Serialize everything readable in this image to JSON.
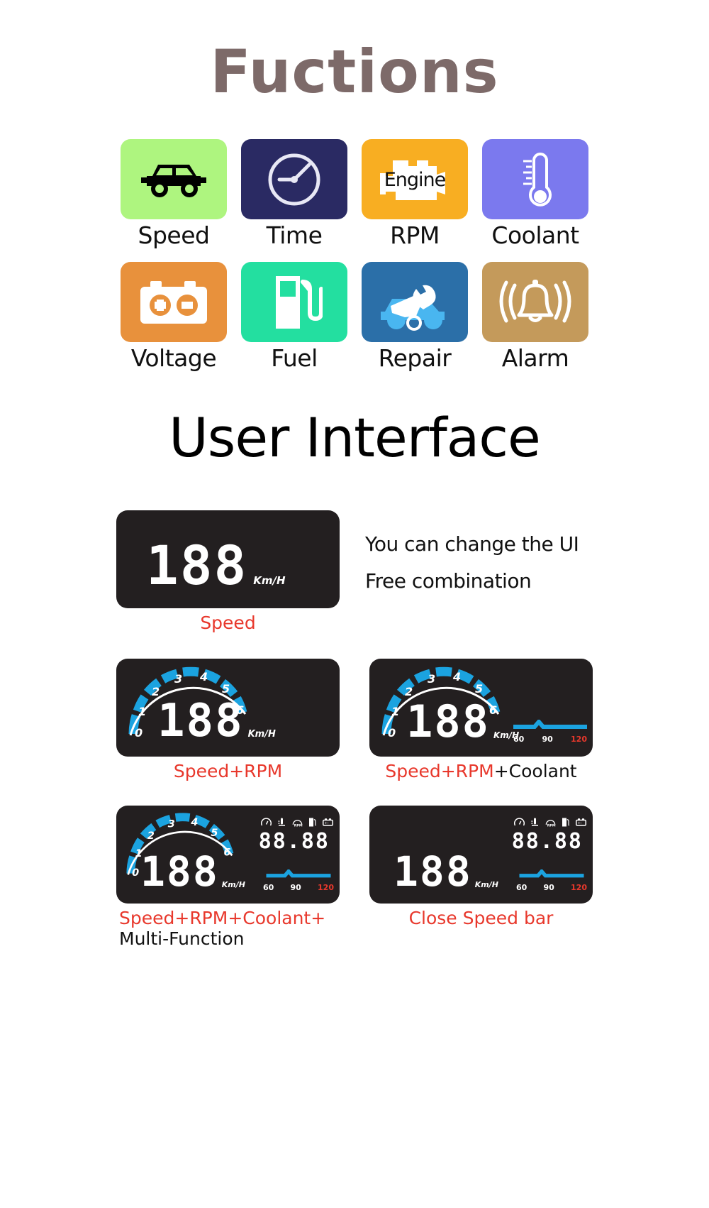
{
  "header": {
    "title": "Fuctions"
  },
  "functions": {
    "items": [
      {
        "label": "Speed",
        "icon": "taxi-car-icon",
        "tile_color": "#aef57f",
        "icon_color": "#000000"
      },
      {
        "label": "Time",
        "icon": "clock-icon",
        "tile_color": "#2a2a63",
        "icon_color": "#e8e8f5"
      },
      {
        "label": "RPM",
        "icon": "engine-block-icon",
        "tile_color": "#f8ae22",
        "icon_color": "#ffffff",
        "inner_text": "Engine"
      },
      {
        "label": "Coolant",
        "icon": "thermometer-icon",
        "tile_color": "#7b79ee",
        "icon_color": "#ffffff"
      },
      {
        "label": "Voltage",
        "icon": "battery-icon",
        "tile_color": "#e8913c",
        "icon_color": "#ffffff"
      },
      {
        "label": "Fuel",
        "icon": "fuel-pump-icon",
        "tile_color": "#23dfa0",
        "icon_color": "#ffffff"
      },
      {
        "label": "Repair",
        "icon": "car-repair-wrench-icon",
        "tile_color": "#2b6fa8",
        "icon_color": "#ffffff"
      },
      {
        "label": "Alarm",
        "icon": "alarm-bell-icon",
        "tile_color": "#c49a5b",
        "icon_color": "#ffffff"
      }
    ]
  },
  "ui_section": {
    "title": "User Interface",
    "note_line1": "You can change the UI",
    "note_line2": "Free combination",
    "panels": [
      {
        "id": "speed",
        "caption_red": "Speed",
        "caption_black": "",
        "value": "188",
        "unit": "Km/H"
      },
      {
        "id": "speed_rpm",
        "caption_red": "Speed+RPM",
        "caption_black": "",
        "value": "188",
        "unit": "Km/H"
      },
      {
        "id": "speed_rpm_coolant",
        "caption_red": "Speed+RPM",
        "caption_black": "+Coolant",
        "value": "188",
        "unit": "Km/H"
      },
      {
        "id": "multi",
        "caption_red": "Speed+RPM+Coolant+",
        "caption_black": "Multi-Function",
        "value": "188",
        "unit": "Km/H",
        "aux_value": "88.88"
      },
      {
        "id": "close_speed_bar",
        "caption_red": "Close  Speed  bar",
        "caption_black": "",
        "value": "188",
        "unit": "Km/H",
        "aux_value": "88.88"
      }
    ],
    "rpm_ticks": [
      "0",
      "1",
      "2",
      "3",
      "4",
      "5",
      "6"
    ],
    "coolant_ticks": [
      "60",
      "90",
      "120"
    ],
    "multi_icons": [
      "speedometer-icon",
      "coolant-temp-icon",
      "rpm-icon",
      "fuel-icon",
      "battery-icon"
    ],
    "colors": {
      "panel_bg": "#231f20",
      "accent_red": "#e8382c",
      "rpm_blue": "#1ba3e0",
      "digit_white": "#ffffff"
    }
  }
}
